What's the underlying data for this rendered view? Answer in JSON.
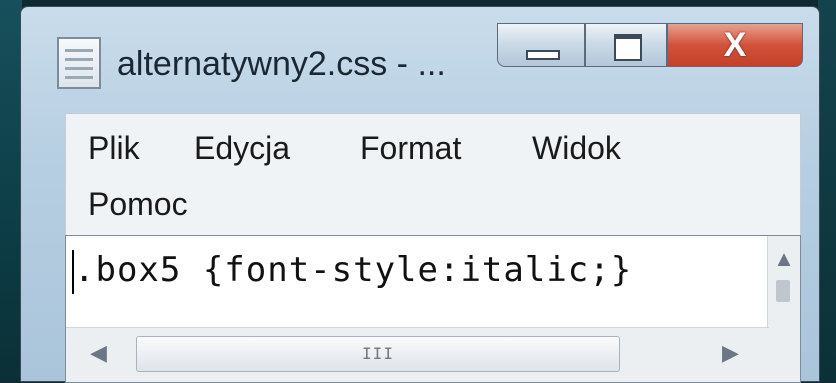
{
  "window": {
    "title": "alternatywny2.css - ...",
    "minimize_glyph": "",
    "maximize_glyph": "",
    "close_glyph": "X"
  },
  "menu": {
    "items": [
      {
        "label": "Plik"
      },
      {
        "label": "Edycja"
      },
      {
        "label": "Format"
      },
      {
        "label": "Widok"
      },
      {
        "label": "Pomoc"
      }
    ]
  },
  "editor": {
    "text": ".box5 {font-style:italic;}"
  },
  "scrollbars": {
    "up_arrow": "▲",
    "left_arrow": "◀",
    "right_arrow": "▶",
    "grip": "III"
  }
}
